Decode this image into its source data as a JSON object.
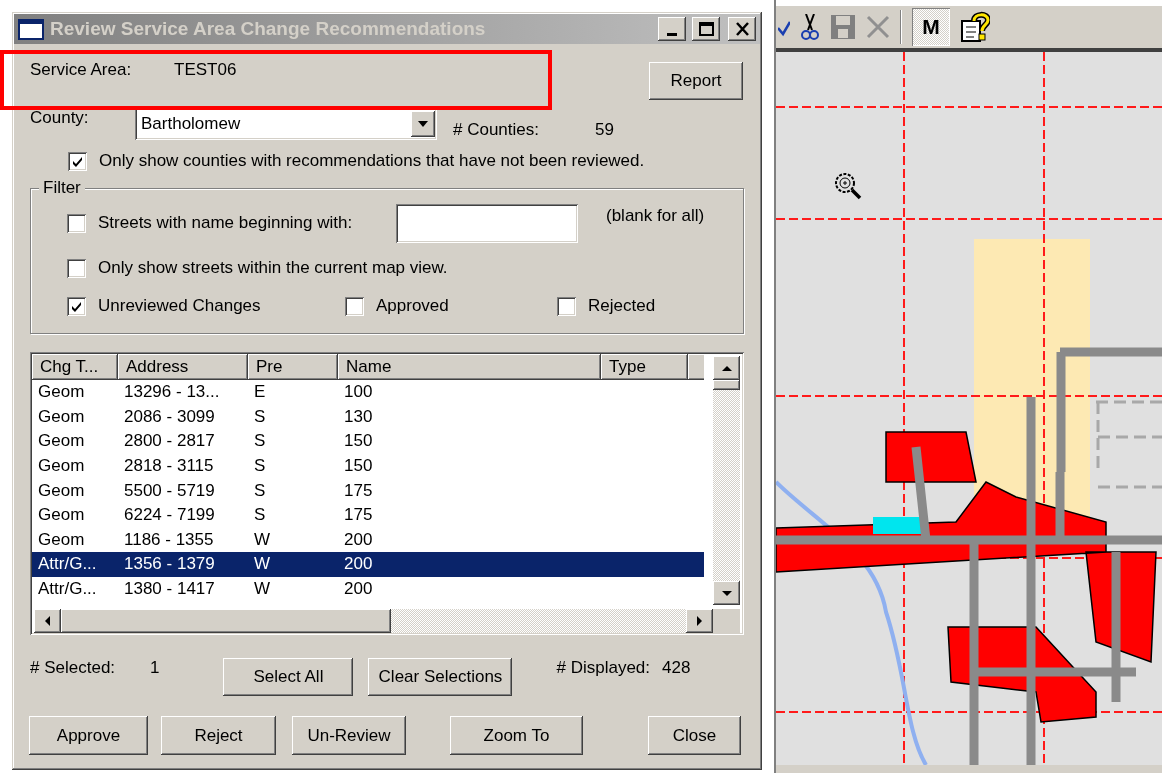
{
  "window": {
    "title": "Review Service Area Change Recommendations"
  },
  "service_area": {
    "label": "Service Area:",
    "value": "TEST06"
  },
  "report_button": "Report",
  "county": {
    "label": "County:",
    "value": "Bartholomew"
  },
  "counties_count": {
    "label": "# Counties:",
    "value": "59"
  },
  "only_unreviewed_counties": {
    "label": "Only show counties with recommendations that have not been reviewed.",
    "checked": true
  },
  "filter": {
    "title": "Filter",
    "options": [
      {
        "kind": "text",
        "label": "Streets with name beginning with:",
        "checked": false,
        "hint": "(blank for all)"
      },
      {
        "kind": "plain",
        "label": "Only show streets within the current map view.",
        "checked": false
      }
    ],
    "status": [
      {
        "label": "Unreviewed Changes",
        "checked": true
      },
      {
        "label": "Approved",
        "checked": false
      },
      {
        "label": "Rejected",
        "checked": false
      }
    ]
  },
  "table": {
    "columns": [
      "Chg T...",
      "Address",
      "Pre",
      "Name",
      "Type"
    ],
    "rows": [
      {
        "cells": [
          "Geom",
          "13296 - 13...",
          "E",
          "100",
          ""
        ],
        "selected": false
      },
      {
        "cells": [
          "Geom",
          "2086 - 3099",
          "S",
          "130",
          ""
        ],
        "selected": false
      },
      {
        "cells": [
          "Geom",
          "2800 - 2817",
          "S",
          "150",
          ""
        ],
        "selected": false
      },
      {
        "cells": [
          "Geom",
          "2818 - 3115",
          "S",
          "150",
          ""
        ],
        "selected": false
      },
      {
        "cells": [
          "Geom",
          "5500 - 5719",
          "S",
          "175",
          ""
        ],
        "selected": false
      },
      {
        "cells": [
          "Geom",
          "6224 - 7199",
          "S",
          "175",
          ""
        ],
        "selected": false
      },
      {
        "cells": [
          "Geom",
          "1186 - 1355",
          "W",
          "200",
          ""
        ],
        "selected": false
      },
      {
        "cells": [
          "Attr/G...",
          "1356 - 1379",
          "W",
          "200",
          ""
        ],
        "selected": true
      },
      {
        "cells": [
          "Attr/G...",
          "1380 - 1417",
          "W",
          "200",
          ""
        ],
        "selected": false
      }
    ]
  },
  "selected_count": {
    "label": "# Selected:",
    "value": "1"
  },
  "selection_buttons": [
    "Select All",
    "Clear Selections"
  ],
  "displayed_count": {
    "label": "# Displayed:",
    "value": "428"
  },
  "action_buttons": [
    "Approve",
    "Reject",
    "Un-Review",
    "Zoom To",
    "Close"
  ],
  "toolbar": {
    "mode_button": {
      "label": "M",
      "pressed": true
    }
  },
  "map": {
    "kind": "picture"
  }
}
